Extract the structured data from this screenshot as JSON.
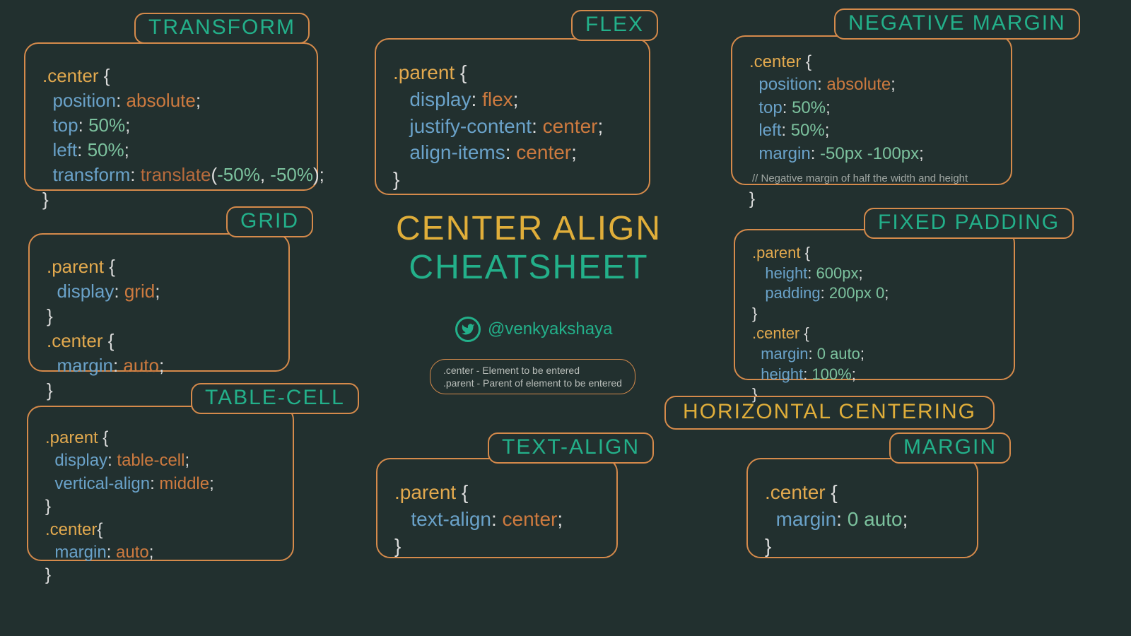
{
  "title": {
    "line1": "CENTER ALIGN",
    "line2": "CHEATSHEET"
  },
  "handle": "@venkyakshaya",
  "legend": {
    "center": ".center - Element to be entered",
    "parent": ".parent - Parent of element to be entered"
  },
  "horizontal_label": "HORIZONTAL CENTERING",
  "cards": {
    "transform": {
      "label": "TRANSFORM",
      "sel": ".center",
      "p1": "position",
      "v1": "absolute",
      "p2": "top",
      "v2": "50%",
      "p3": "left",
      "v3": "50%",
      "p4": "transform",
      "v4fn": "translate",
      "v4a": "-50%",
      "v4b": "-50%"
    },
    "flex": {
      "label": "FLEX",
      "sel": ".parent",
      "p1": "display",
      "v1": "flex",
      "p2": "justify-content",
      "v2": "center",
      "p3": "align-items",
      "v3": "center"
    },
    "negmargin": {
      "label": "NEGATIVE MARGIN",
      "sel": ".center",
      "p1": "position",
      "v1": "absolute",
      "p2": "top",
      "v2": "50%",
      "p3": "left",
      "v3": "50%",
      "p4": "margin",
      "v4": "-50px -100px",
      "comment": "// Negative margin of half the width and height"
    },
    "grid": {
      "label": "GRID",
      "sel1": ".parent",
      "p1": "display",
      "v1": "grid",
      "sel2": ".center",
      "p2": "margin",
      "v2": "auto"
    },
    "tablecell": {
      "label": "TABLE-CELL",
      "sel1": ".parent",
      "p1": "display",
      "v1": "table-cell",
      "p2": "vertical-align",
      "v2": "middle",
      "sel2": ".center",
      "p3": "margin",
      "v3": "auto"
    },
    "fixedpad": {
      "label": "FIXED PADDING",
      "sel1": ".parent",
      "p1": "height",
      "v1": "600px",
      "p2": "padding",
      "v2": "200px 0",
      "sel2": ".center",
      "p3": "margin",
      "v3": "0 auto",
      "p4": "height",
      "v4": "100%"
    },
    "textalign": {
      "label": "TEXT-ALIGN",
      "sel": ".parent",
      "p1": "text-align",
      "v1": "center"
    },
    "margin": {
      "label": "MARGIN",
      "sel": ".center",
      "p1": "margin",
      "v1": "0 auto"
    }
  }
}
